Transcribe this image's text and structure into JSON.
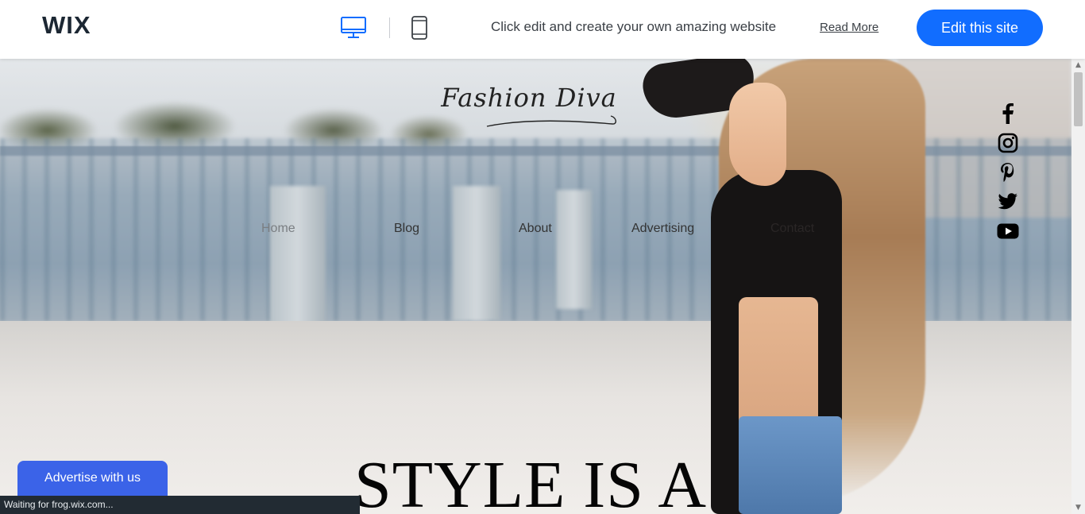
{
  "wixbar": {
    "logo": "WIX",
    "promo_text": "Click edit and create your own amazing website",
    "read_more": "Read More",
    "edit_button": "Edit this site",
    "accent": "#116dff",
    "selected_view": "desktop"
  },
  "site": {
    "logo_text": "Fashion Diva",
    "nav": [
      "Home",
      "Blog",
      "About",
      "Advertising",
      "Contact"
    ],
    "social": [
      "facebook-icon",
      "instagram-icon",
      "pinterest-icon",
      "twitter-icon",
      "youtube-icon"
    ],
    "headline": "STYLE IS A"
  },
  "advertise_button": "Advertise with us",
  "browser_status": "Waiting for frog.wix.com..."
}
